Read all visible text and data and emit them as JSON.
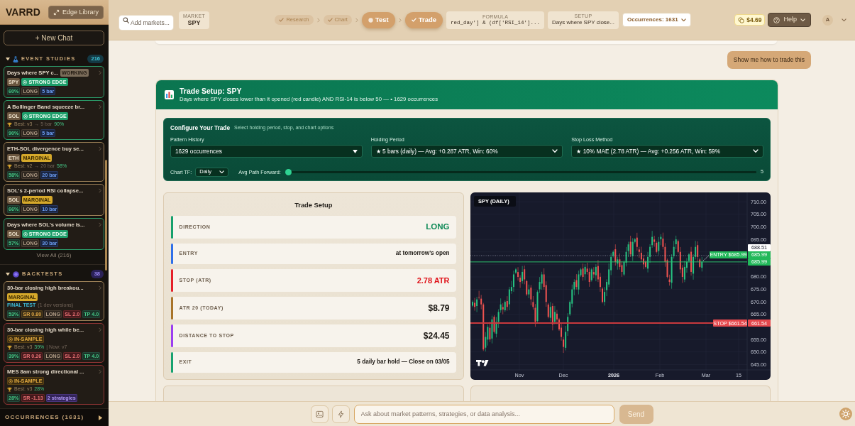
{
  "sidebar": {
    "logo": "VARRD",
    "library_button": "Edge Library",
    "new_chat_button": "+ New Chat",
    "sections": [
      {
        "kind": "studies",
        "title": "EVENT STUDIES",
        "count": "216",
        "expanded": true,
        "items": [
          {
            "title": "Days where SPY c...",
            "badge": "WORKING",
            "tags": [
              {
                "text": "SPY",
                "kind": "symbol"
              },
              {
                "text": "STRONG EDGE",
                "kind": "strong"
              }
            ],
            "stats": [
              {
                "text": "60%",
                "kind": "win"
              },
              {
                "text": "LONG",
                "kind": "side"
              },
              {
                "text": "5 bar",
                "kind": "hold"
              }
            ]
          },
          {
            "title": "A Bollinger Band squeeze br...",
            "tags": [
              {
                "text": "SOL",
                "kind": "symbol"
              },
              {
                "text": "STRONG EDGE",
                "kind": "strong"
              }
            ],
            "note": {
              "trophy": true,
              "parts": [
                {
                  "text": "Best: v3",
                  "kind": "version"
                },
                {
                  "text": "→ 5 bar",
                  "kind": "detail"
                },
                {
                  "text": "90%",
                  "kind": "win"
                }
              ]
            },
            "stats": [
              {
                "text": "90%",
                "kind": "win"
              },
              {
                "text": "LONG",
                "kind": "side"
              },
              {
                "text": "5 bar",
                "kind": "hold"
              }
            ]
          },
          {
            "title": "ETH-SOL divergence buy se...",
            "tags": [
              {
                "text": "ETH",
                "kind": "symbol"
              },
              {
                "text": "MARGINAL",
                "kind": "marginal"
              }
            ],
            "note": {
              "trophy": true,
              "parts": [
                {
                  "text": "Best: v2",
                  "kind": "version"
                },
                {
                  "text": "→ 20 bar",
                  "kind": "detail"
                },
                {
                  "text": "58%",
                  "kind": "win"
                }
              ]
            },
            "stats": [
              {
                "text": "58%",
                "kind": "win"
              },
              {
                "text": "LONG",
                "kind": "side"
              },
              {
                "text": "20 bar",
                "kind": "hold"
              }
            ]
          },
          {
            "title": "SOL's 2-period RSI collapse...",
            "tags": [
              {
                "text": "SOL",
                "kind": "symbol"
              },
              {
                "text": "MARGINAL",
                "kind": "marginal"
              }
            ],
            "stats": [
              {
                "text": "66%",
                "kind": "win"
              },
              {
                "text": "LONG",
                "kind": "side"
              },
              {
                "text": "10 bar",
                "kind": "hold"
              }
            ]
          },
          {
            "title": "Days where SOL's volume is...",
            "tags": [
              {
                "text": "SOL",
                "kind": "symbol"
              },
              {
                "text": "STRONG EDGE",
                "kind": "strong"
              }
            ],
            "stats": [
              {
                "text": "57%",
                "kind": "win"
              },
              {
                "text": "LONG",
                "kind": "side"
              },
              {
                "text": "30 bar",
                "kind": "hold"
              }
            ]
          }
        ],
        "view_all": "View All (216)"
      },
      {
        "kind": "backtests",
        "title": "BACKTESTS",
        "count": "38",
        "expanded": true,
        "items": [
          {
            "title": "30-bar closing high breakou...",
            "tags": [
              {
                "text": "MARGINAL",
                "kind": "marginal"
              }
            ],
            "note": {
              "trophy": false,
              "parts": [
                {
                  "text": "FINAL TEST",
                  "kind": "final"
                },
                {
                  "text": "(1 dev versions)",
                  "kind": "detail"
                }
              ]
            },
            "stats": [
              {
                "text": "53%",
                "kind": "win"
              },
              {
                "text": "SR 0.80",
                "kind": "sharpe_fair"
              },
              {
                "text": "LONG",
                "kind": "side"
              },
              {
                "text": "SL 2.0",
                "kind": "stop"
              },
              {
                "text": "TP 4.0",
                "kind": "target"
              }
            ]
          },
          {
            "title": "30-bar closing high while be...",
            "tags": [
              {
                "text": "IN-SAMPLE",
                "kind": "in_sample"
              }
            ],
            "note": {
              "trophy": true,
              "parts": [
                {
                  "text": "Best: v3",
                  "kind": "version"
                },
                {
                  "text": "39%",
                  "kind": "win"
                },
                {
                  "text": "| Now: v7",
                  "kind": "detail"
                }
              ]
            },
            "stats": [
              {
                "text": "39%",
                "kind": "win"
              },
              {
                "text": "SR 0.26",
                "kind": "sharpe_weak"
              },
              {
                "text": "LONG",
                "kind": "side"
              },
              {
                "text": "SL 2.0",
                "kind": "stop"
              },
              {
                "text": "TP 4.0",
                "kind": "target"
              }
            ]
          },
          {
            "title": "MES 8am strong directional ...",
            "tags": [
              {
                "text": "IN-SAMPLE",
                "kind": "in_sample"
              }
            ],
            "note": {
              "trophy": true,
              "parts": [
                {
                  "text": "Best: v3",
                  "kind": "version"
                },
                {
                  "text": "28%",
                  "kind": "win"
                }
              ]
            },
            "stats": [
              {
                "text": "28%",
                "kind": "win"
              },
              {
                "text": "SR -1.13",
                "kind": "sharpe_weak"
              },
              {
                "text": "2 strategies",
                "kind": "count"
              }
            ]
          }
        ]
      }
    ],
    "footer": {
      "label": "OCCURRENCES (1631)",
      "expanded": false
    }
  },
  "topbar": {
    "search": {
      "placeholder": "Add markets..."
    },
    "market": {
      "label": "MARKET",
      "value": "SPY"
    },
    "steps": [
      {
        "label": "Research",
        "kind": "done",
        "emphasized": false
      },
      {
        "label": "Chart",
        "kind": "done",
        "emphasized": false
      },
      {
        "label": "Test",
        "kind": "current",
        "emphasized": true
      },
      {
        "label": "Trade",
        "kind": "done",
        "emphasized": true
      }
    ],
    "formula": {
      "label": "FORMULA",
      "value": "red_day'] & (df['RSI_14']..."
    },
    "setup": {
      "label": "SETUP",
      "value": "Days where SPY close..."
    },
    "occurrences_button": "Occurrences: 1631",
    "balance": "$4.69",
    "help_button": "Help",
    "avatar": "A"
  },
  "chat": {
    "user_message": "Show me how to trade this"
  },
  "trade_panel": {
    "title": "Trade Setup: SPY",
    "subtitle": "Days where SPY closes lower than it opened (red candle) AND RSI-14 is below 50 — • 1629 occurrences",
    "config": {
      "title": "Configure Your Trade",
      "hint": "Select holding period, stop, and chart options",
      "selects": [
        {
          "label": "Pattern History",
          "value": "1629 occurrences",
          "kind": "triangle"
        },
        {
          "label": "Holding Period",
          "value": "★ 5 bars (daily) — Avg: +0.287 ATR, Win: 60%",
          "kind": "chevron"
        },
        {
          "label": "Stop Loss Method",
          "value": "★ 10% MAE (2.78 ATR) — Avg: +0.256 ATR, Win: 59%",
          "kind": "chevron"
        }
      ],
      "timeframe": {
        "label": "Chart TF:",
        "value": "Daily"
      },
      "path_slider": {
        "label": "Avg Path Forward:",
        "level": 0,
        "reading": "5"
      }
    },
    "setup_card": {
      "title": "Trade Setup",
      "rows": [
        {
          "label": "DIRECTION",
          "value": "LONG",
          "color": "#16a06c",
          "kind": "positive"
        },
        {
          "label": "ENTRY",
          "value": "at tomorrow's open",
          "color": "#2f6fe8",
          "kind": "note"
        },
        {
          "label": "STOP (ATR)",
          "value": "2.78 ATR",
          "color": "#e5202a",
          "kind": "negative"
        },
        {
          "label": "ATR 20 (TODAY)",
          "value": "$8.79",
          "color": "#a8742a",
          "kind": "figure"
        },
        {
          "label": "DISTANCE TO STOP",
          "value": "$24.45",
          "color": "#9b3df0",
          "kind": "figure"
        },
        {
          "label": "EXIT",
          "value": "5 daily bar hold — Close on 03/05",
          "color": "#17a26f",
          "kind": "note"
        }
      ]
    },
    "chart": {
      "title": "SPY (DAILY)",
      "y_labels": [
        "710.00",
        "705.00",
        "700.00",
        "695.00",
        "680.00",
        "675.00",
        "670.00",
        "665.00",
        "655.00",
        "650.00",
        "645.00"
      ],
      "x_labels": [
        {
          "text": "Nov",
          "kind": "month"
        },
        {
          "text": "Dec",
          "kind": "month"
        },
        {
          "text": "2026",
          "kind": "year"
        },
        {
          "text": "Feb",
          "kind": "month"
        },
        {
          "text": "Mar",
          "kind": "month"
        },
        {
          "text": "15",
          "kind": "day"
        }
      ],
      "price_tags": [
        {
          "text": "688.51",
          "kind": "last"
        },
        {
          "text": "685.99",
          "kind": "entry"
        },
        {
          "text": "685.99",
          "kind": "entry"
        },
        {
          "text": "661.54",
          "kind": "stop"
        }
      ],
      "entry_label": "ENTRY $685.99",
      "stop_label": "STOP $661.54"
    }
  },
  "composer": {
    "placeholder": "Ask about market patterns, strategies, or data analysis...",
    "send_button": "Send",
    "send_disabled": true
  }
}
